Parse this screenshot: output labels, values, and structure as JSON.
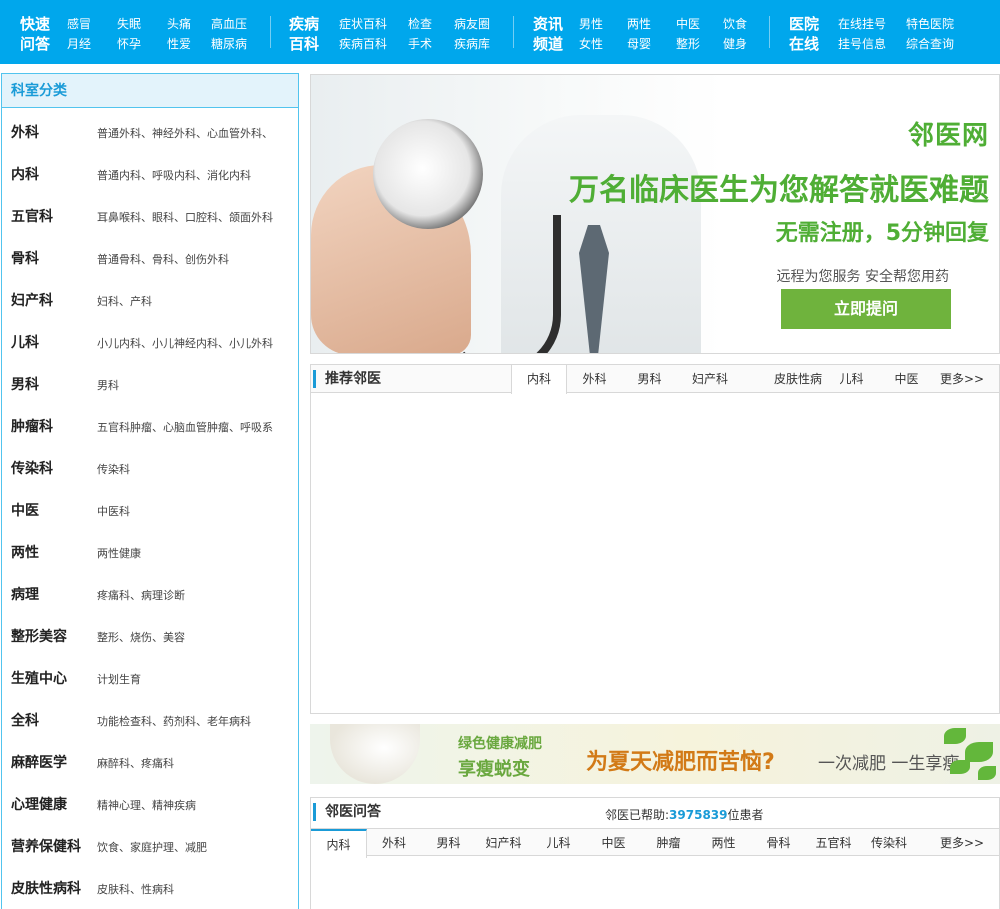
{
  "nav": {
    "groups": [
      {
        "title1": "快速",
        "title2": "问答",
        "links": [
          [
            "感冒",
            "失眠",
            "头痛",
            "高血压"
          ],
          [
            "月经",
            "怀孕",
            "性爱",
            "糖尿病"
          ]
        ]
      },
      {
        "title1": "疾病",
        "title2": "百科",
        "links": [
          [
            "症状百科",
            "检查",
            "病友圈"
          ],
          [
            "疾病百科",
            "手术",
            "疾病库"
          ]
        ]
      },
      {
        "title1": "资讯",
        "title2": "频道",
        "links": [
          [
            "男性",
            "两性",
            "中医",
            "饮食"
          ],
          [
            "女性",
            "母婴",
            "整形",
            "健身"
          ]
        ]
      },
      {
        "title1": "医院",
        "title2": "在线",
        "links": [
          [
            "在线挂号",
            "特色医院"
          ],
          [
            "挂号信息",
            "综合查询"
          ]
        ]
      }
    ]
  },
  "sidebar": {
    "title": "科室分类",
    "items": [
      {
        "name": "外科",
        "subs": "普通外科、神经外科、心血管外科、"
      },
      {
        "name": "内科",
        "subs": "普通内科、呼吸内科、消化内科"
      },
      {
        "name": "五官科",
        "subs": "耳鼻喉科、眼科、口腔科、颌面外科"
      },
      {
        "name": "骨科",
        "subs": "普通骨科、骨科、创伤外科"
      },
      {
        "name": "妇产科",
        "subs": "妇科、产科"
      },
      {
        "name": "儿科",
        "subs": "小儿内科、小儿神经内科、小儿外科"
      },
      {
        "name": "男科",
        "subs": "男科"
      },
      {
        "name": "肿瘤科",
        "subs": "五官科肿瘤、心脑血管肿瘤、呼吸系"
      },
      {
        "name": "传染科",
        "subs": "传染科"
      },
      {
        "name": "中医",
        "subs": "中医科"
      },
      {
        "name": "两性",
        "subs": "两性健康"
      },
      {
        "name": "病理",
        "subs": "疼痛科、病理诊断"
      },
      {
        "name": "整形美容",
        "subs": "整形、烧伤、美容"
      },
      {
        "name": "生殖中心",
        "subs": "计划生育"
      },
      {
        "name": "全科",
        "subs": "功能检查科、药剂科、老年病科"
      },
      {
        "name": "麻醉医学",
        "subs": "麻醉科、疼痛科"
      },
      {
        "name": "心理健康",
        "subs": "精神心理、精神疾病"
      },
      {
        "name": "营养保健科",
        "subs": "饮食、家庭护理、减肥"
      },
      {
        "name": "皮肤性病科",
        "subs": "皮肤科、性病科"
      }
    ]
  },
  "banner": {
    "logo": "邻医网",
    "headline": "万名临床医生为您解答就医难题",
    "subheadline": "无需注册，5分钟回复",
    "tagline": "远程为您服务  安全帮您用药",
    "button": "立即提问"
  },
  "recommend": {
    "title": "推荐邻医",
    "tabs": [
      "内科",
      "外科",
      "男科",
      "妇产科",
      "皮肤性病",
      "儿科",
      "中医",
      "更多>>"
    ]
  },
  "ad": {
    "line1": "绿色健康减肥",
    "line2": "享瘦蜕变",
    "headline": "为夏天减肥而苦恼?",
    "slogan": "一次减肥 一生享瘦"
  },
  "qa": {
    "title": "邻医问答",
    "helped_prefix": "邻医已帮助:",
    "helped_count": "3975839",
    "helped_suffix": "位患者",
    "tabs": [
      "内科",
      "外科",
      "男科",
      "妇产科",
      "儿科",
      "中医",
      "肿瘤",
      "两性",
      "骨科",
      "五官科",
      "传染科",
      "更多>>"
    ]
  },
  "colors": {
    "nav_bg": "#00a7ec",
    "accent": "#1a9bd7",
    "banner_green": "#4fae35",
    "button_green": "#6fb33d"
  }
}
